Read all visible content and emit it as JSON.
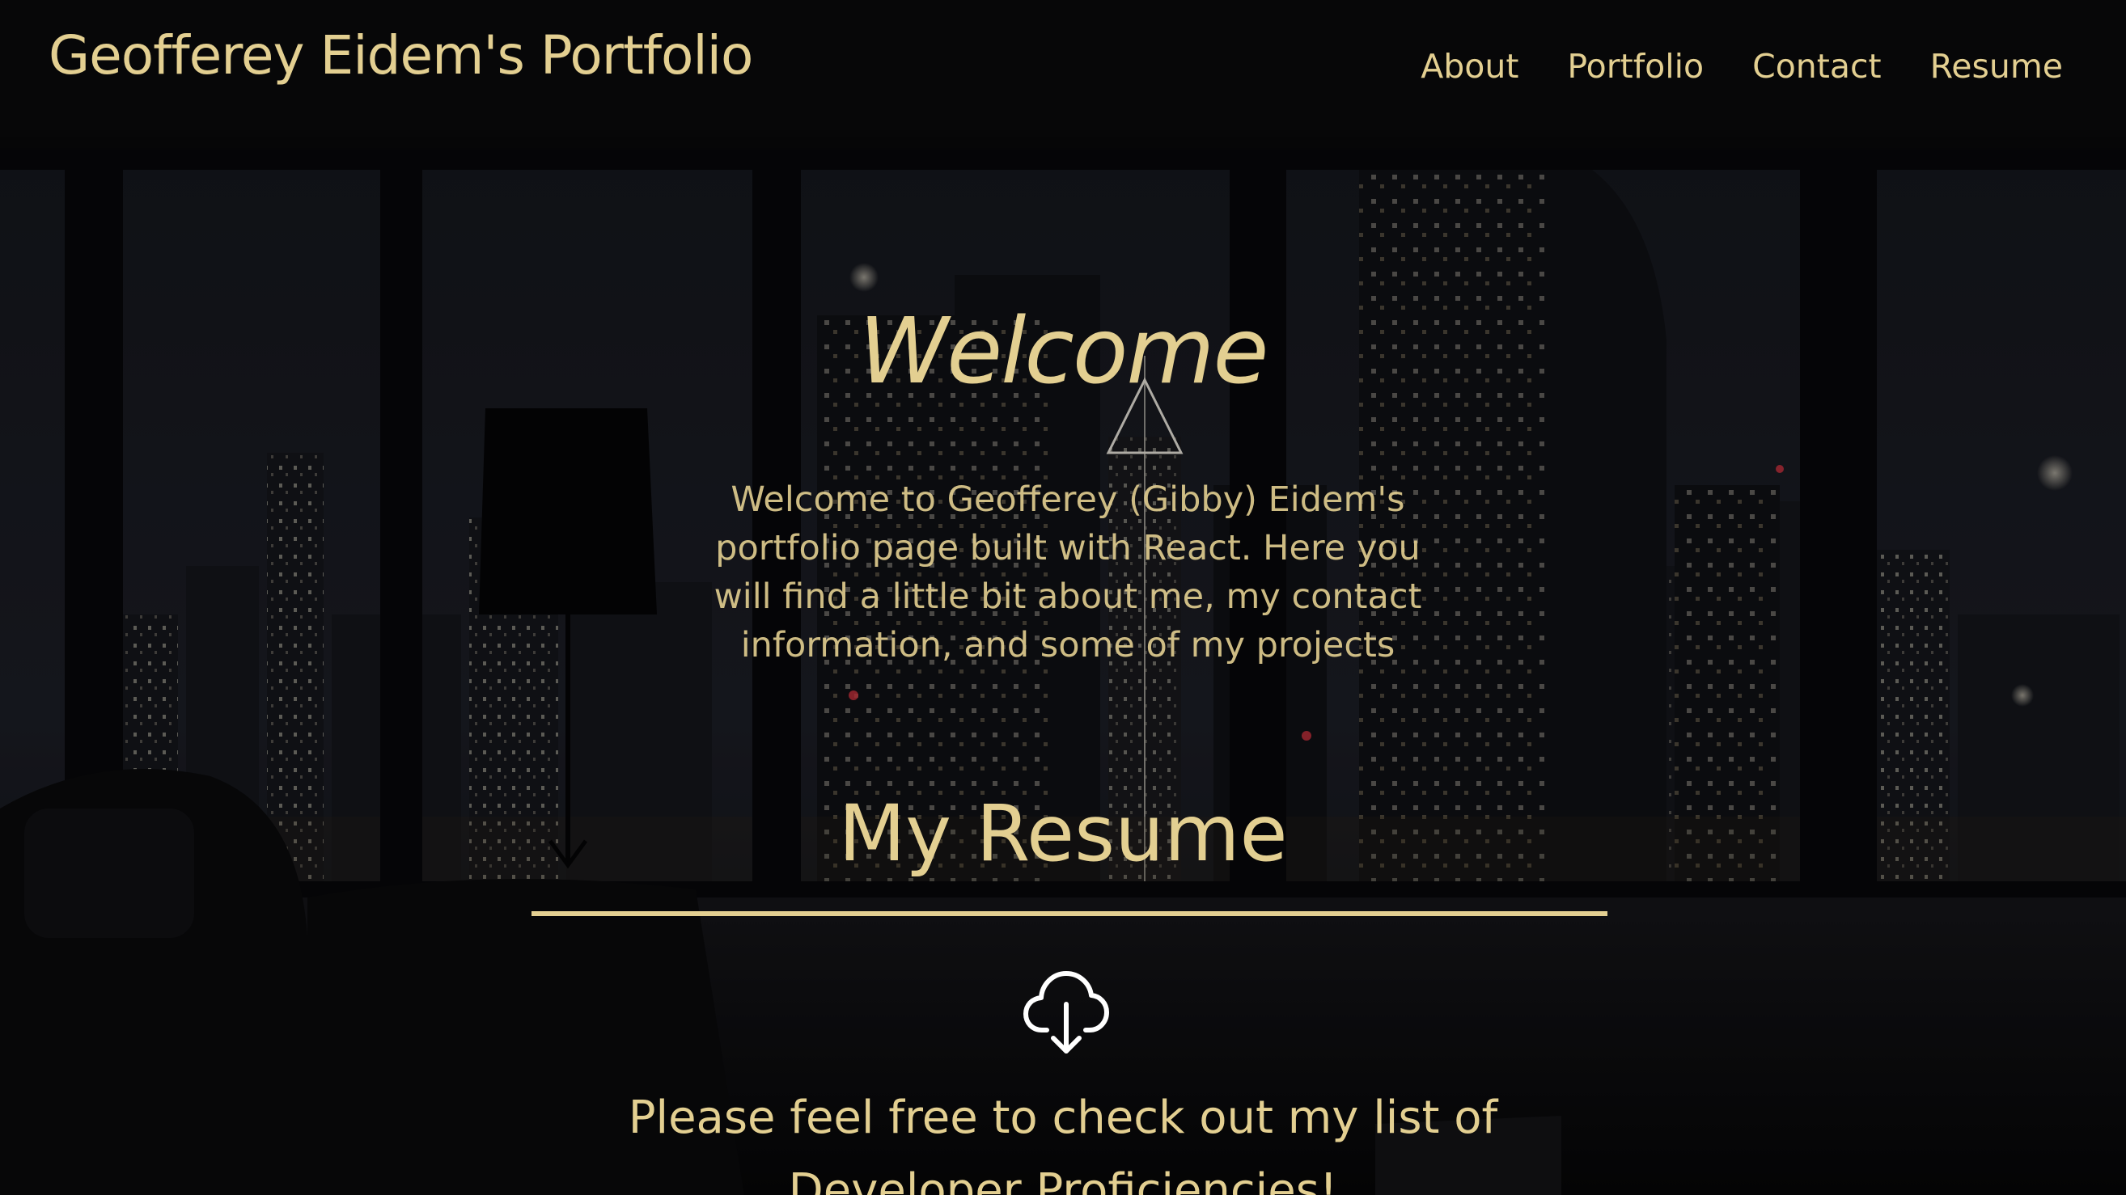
{
  "header": {
    "brand": "Geofferey Eidem's Portfolio",
    "nav": [
      {
        "label": "About"
      },
      {
        "label": "Portfolio"
      },
      {
        "label": "Contact"
      },
      {
        "label": "Resume"
      }
    ]
  },
  "hero": {
    "title": "Welcome",
    "text": "Welcome to Geofferey (Gibby) Eidem's portfolio page built with React. Here you will find a little bit about me, my contact information, and some of my projects"
  },
  "resume": {
    "title": "My Resume",
    "download_icon": "cloud-download-icon",
    "text": "Please feel free to check out my list of Developer Proficiencies!"
  },
  "colors": {
    "accent": "#e3cf91",
    "header_bg": "#060607",
    "page_bg": "#0b0b0d"
  }
}
